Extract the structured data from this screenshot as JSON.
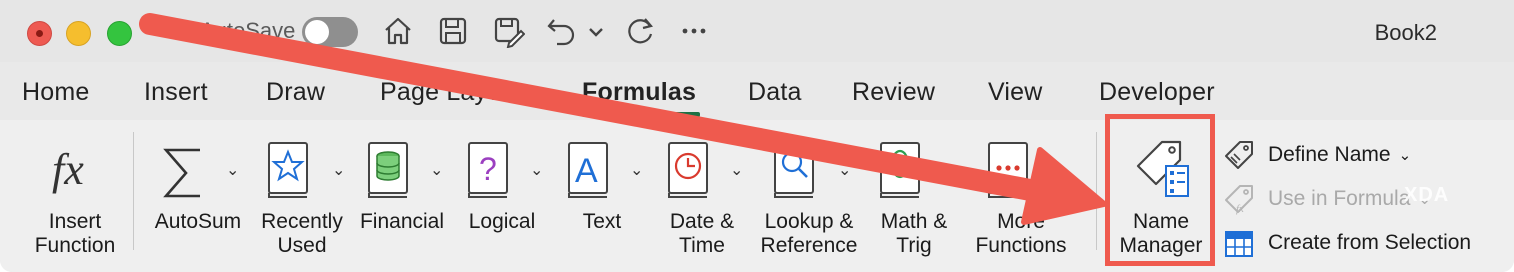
{
  "titlebar": {
    "autosave_label": "AutoSave",
    "document_title": "Book2",
    "icons": [
      "home-icon",
      "save-icon",
      "save-as-icon",
      "undo-icon",
      "chevron-down-icon",
      "redo-icon",
      "more-icon"
    ]
  },
  "tabs": [
    {
      "label": "Home"
    },
    {
      "label": "Insert"
    },
    {
      "label": "Draw"
    },
    {
      "label": "Page Layout"
    },
    {
      "label": "Formulas",
      "active": true
    },
    {
      "label": "Data"
    },
    {
      "label": "Review"
    },
    {
      "label": "View"
    },
    {
      "label": "Developer"
    }
  ],
  "ribbon": {
    "insert_function": {
      "line1": "Insert",
      "line2": "Function"
    },
    "autosum": {
      "line1": "AutoSum"
    },
    "recently_used": {
      "line1": "Recently",
      "line2": "Used"
    },
    "financial": {
      "line1": "Financial"
    },
    "logical": {
      "line1": "Logical"
    },
    "text": {
      "line1": "Text"
    },
    "date_time": {
      "line1": "Date &",
      "line2": "Time"
    },
    "lookup": {
      "line1": "Lookup &",
      "line2": "Reference"
    },
    "math": {
      "line1": "Math &",
      "line2": "Trig"
    },
    "more": {
      "line1": "More",
      "line2": "Functions"
    },
    "name_manager": {
      "line1": "Name",
      "line2": "Manager"
    },
    "define_name": "Define Name",
    "use_in_formula": "Use in Formula",
    "create_from_selection": "Create from Selection"
  },
  "watermark": "XDA",
  "colors": {
    "annotation_red": "#ef5a4e",
    "active_tab_green": "#1e7145"
  }
}
